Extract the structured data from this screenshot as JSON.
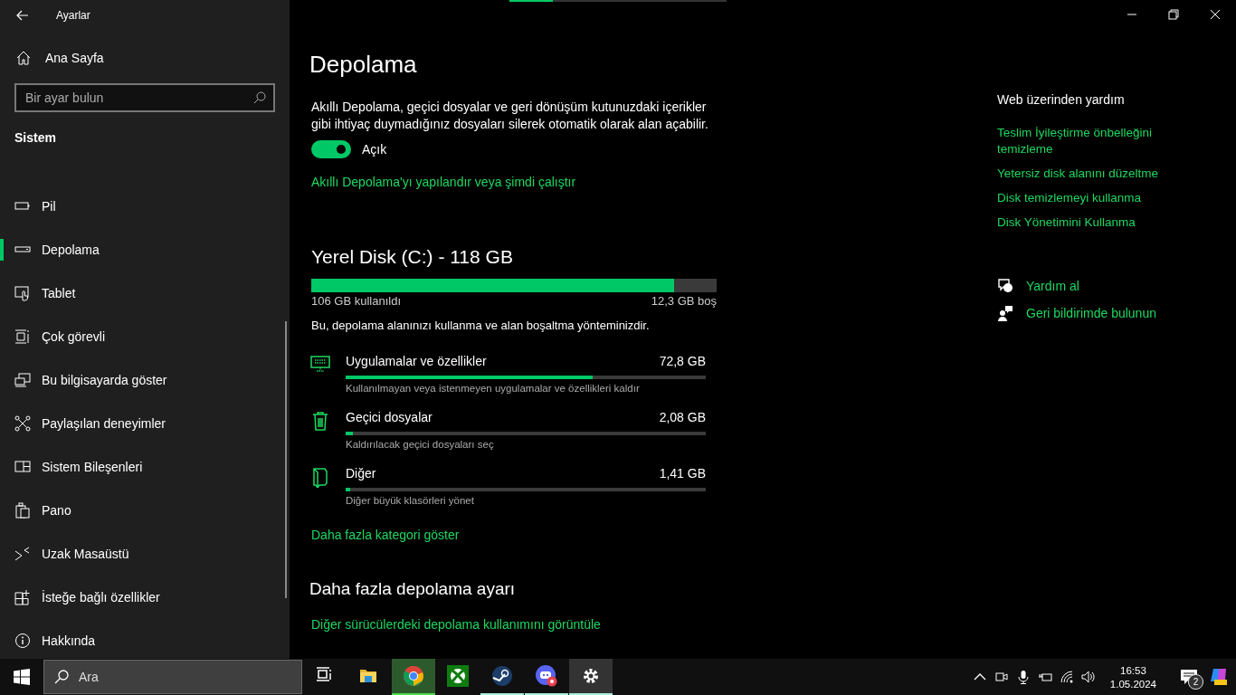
{
  "window": {
    "title": "Ayarlar"
  },
  "loading_bar": {
    "level": 0.2
  },
  "sidebar": {
    "home": "Ana Sayfa",
    "search": {
      "placeholder": "Bir ayar bulun"
    },
    "section": "Sistem",
    "items": [
      {
        "label": "Pil",
        "selected": false
      },
      {
        "label": "Depolama",
        "selected": true
      },
      {
        "label": "Tablet",
        "selected": false
      },
      {
        "label": "Çok görevli",
        "selected": false
      },
      {
        "label": "Bu bilgisayarda göster",
        "selected": false
      },
      {
        "label": "Paylaşılan deneyimler",
        "selected": false
      },
      {
        "label": "Sistem Bileşenleri",
        "selected": false
      },
      {
        "label": "Pano",
        "selected": false
      },
      {
        "label": "Uzak Masaüstü",
        "selected": false
      },
      {
        "label": "İsteğe bağlı özellikler",
        "selected": false
      },
      {
        "label": "Hakkında",
        "selected": false
      }
    ]
  },
  "page": {
    "title": "Depolama",
    "description": "Akıllı Depolama, geçici dosyalar ve geri dönüşüm kutunuzdaki içerikler gibi ihtiyaç duymadığınız dosyaları silerek otomatik olarak alan açabilir.",
    "toggle": {
      "on": true,
      "label": "Açık"
    },
    "configure_link": "Akıllı Depolama'yı yapılandır veya şimdi çalıştır",
    "disk": {
      "title": "Yerel Disk (C:) - 118 GB",
      "level": 0.895,
      "used": "106 GB kullanıldı",
      "free": "12,3 GB boş",
      "intro": "Bu, depolama alanınızı kullanma ve alan boşaltma yönteminizdir.",
      "categories": [
        {
          "name": "Uygulamalar ve özellikler",
          "size": "72,8 GB",
          "level": 0.686,
          "hint": "Kullanılmayan veya istenmeyen uygulamalar ve özellikleri kaldır"
        },
        {
          "name": "Geçici dosyalar",
          "size": "2,08 GB",
          "level": 0.02,
          "hint": "Kaldırılacak geçici dosyaları seç"
        },
        {
          "name": "Diğer",
          "size": "1,41 GB",
          "level": 0.012,
          "hint": "Diğer büyük klasörleri yönet"
        }
      ],
      "more_link": "Daha fazla kategori göster"
    },
    "more_title": "Daha fazla depolama ayarı",
    "other_drives_link": "Diğer sürücülerdeki depolama kullanımını görüntüle"
  },
  "help": {
    "title": "Web üzerinden yardım",
    "links": [
      "Teslim İyileştirme önbelleğini temizleme",
      "Yetersiz disk alanını düzeltme",
      "Disk temizlemeyi kullanma",
      "Disk Yönetimini Kullanma"
    ],
    "actions": [
      "Yardım al",
      "Geri bildirimde bulunun"
    ]
  },
  "taskbar": {
    "search": {
      "placeholder": "Ara"
    },
    "apps": [
      {
        "running": false,
        "selected": false,
        "attention": false
      },
      {
        "running": false,
        "selected": false,
        "attention": false
      },
      {
        "running": true,
        "selected": false,
        "attention": true
      },
      {
        "running": false,
        "selected": false,
        "attention": false
      },
      {
        "running": true,
        "selected": false,
        "attention": false
      },
      {
        "running": true,
        "selected": false,
        "attention": false
      },
      {
        "running": true,
        "selected": true,
        "attention": false
      }
    ],
    "time": "16:53",
    "date": "1.05.2024",
    "notifications": "2"
  }
}
